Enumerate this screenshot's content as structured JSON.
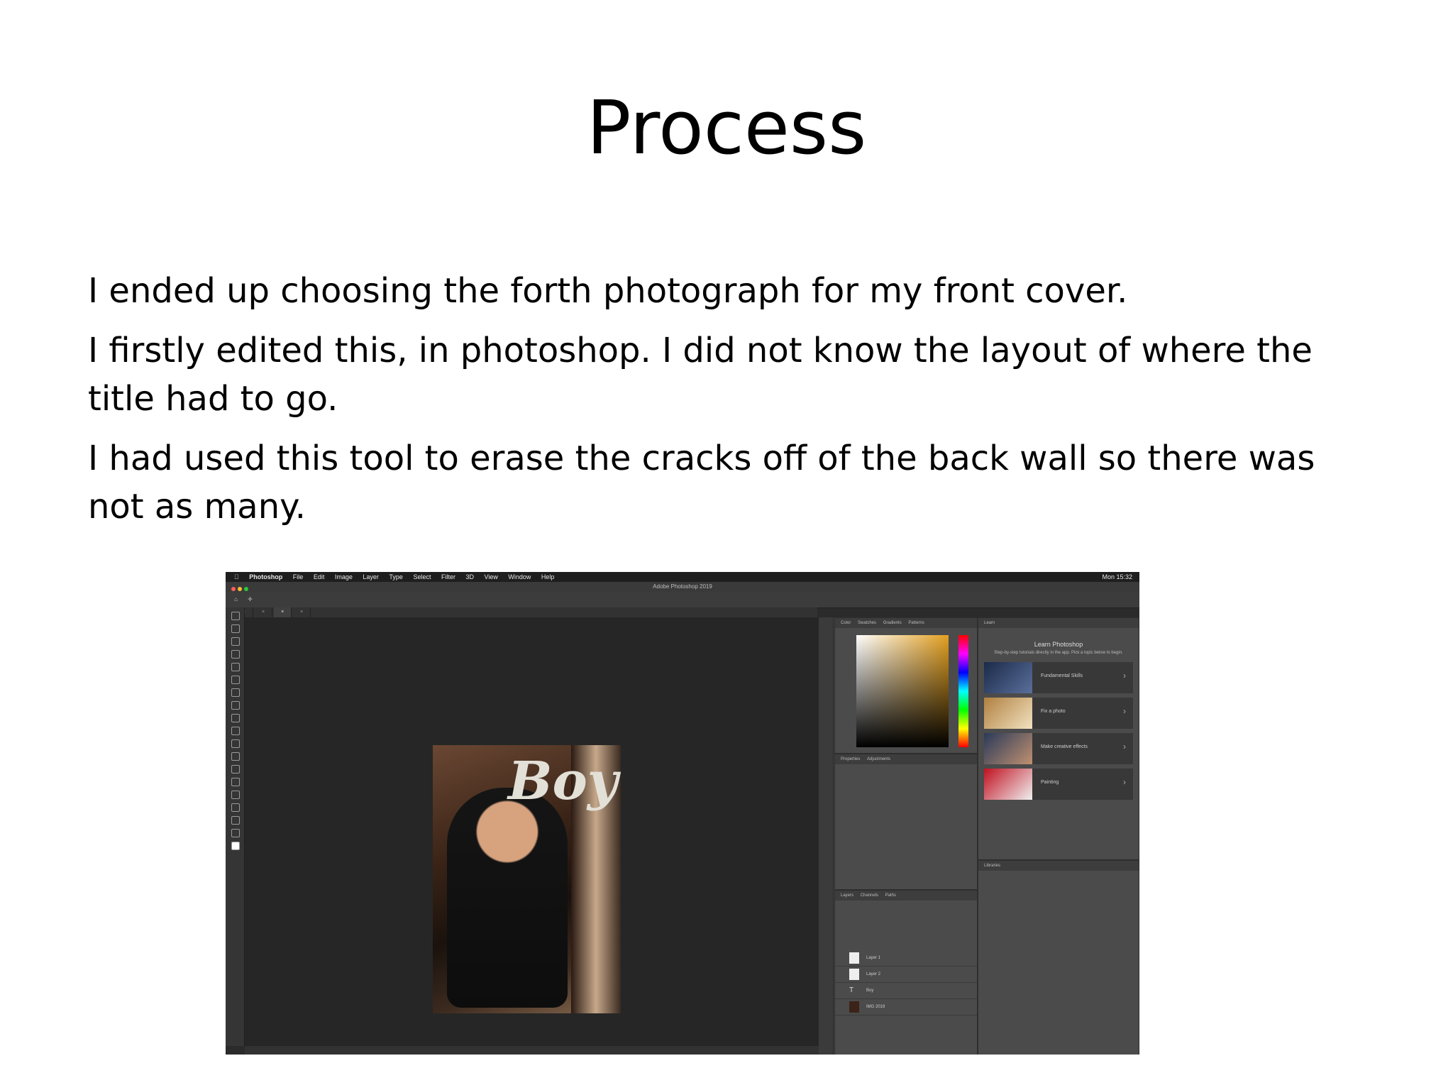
{
  "slide": {
    "title": "Process",
    "paragraphs": [
      "I ended up choosing the forth photograph for my front cover.",
      "I firstly edited this, in photoshop. I did not know the layout of where the title had to go.",
      "I had used this tool to erase the cracks off of the back wall so there was not as many."
    ]
  },
  "screenshot": {
    "menubar": [
      "Photoshop",
      "File",
      "Edit",
      "Image",
      "Layer",
      "Type",
      "Select",
      "Filter",
      "3D",
      "View",
      "Window",
      "Help"
    ],
    "clock": "Mon 15:32",
    "window_title": "Adobe Photoshop 2019",
    "colors": {
      "accent": "#e3a021",
      "ui_dark": "#2b2b2b",
      "panel": "#4b4b4b"
    },
    "canvas_text": "Boy",
    "color_panel_tabs": [
      "Color",
      "Swatches",
      "Gradients",
      "Patterns"
    ],
    "learn_panel": {
      "tab": "Learn",
      "title": "Learn Photoshop",
      "subtitle": "Step-by-step tutorials directly in the app. Pick a topic below to begin.",
      "items": [
        "Fundamental Skills",
        "Fix a photo",
        "Make creative effects",
        "Painting"
      ]
    },
    "properties_tabs": [
      "Properties",
      "Adjustments"
    ],
    "layers_tabs": [
      "Layers",
      "Channels",
      "Paths"
    ],
    "layers": [
      "Layer 1",
      "Layer 2",
      "Boy",
      "IMG 2019"
    ],
    "libraries_tab": "Libraries"
  }
}
